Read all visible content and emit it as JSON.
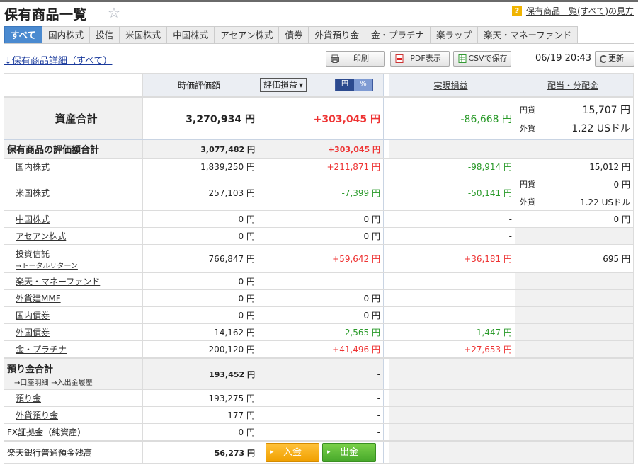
{
  "page": {
    "title": "保有商品一覧",
    "help_link": "保有商品一覧(すべて)の見方",
    "help_mark": "?"
  },
  "tabs": [
    "すべて",
    "国内株式",
    "投信",
    "米国株式",
    "中国株式",
    "アセアン株式",
    "債券",
    "外貨預り金",
    "金・プラチナ",
    "楽ラップ",
    "楽天・マネーファンド"
  ],
  "toolbar": {
    "detail_link": "↓保有商品詳細（すべて）",
    "print": "印刷",
    "pdf": "PDF表示",
    "csv": "CSVで保存",
    "datetime": "06/19 20:43",
    "refresh": "更新"
  },
  "header": {
    "market_value": "時価評価額",
    "select_value": "評価損益",
    "unit_yen": "円",
    "unit_pct": "%",
    "realized": "実現損益",
    "dividend": "配当・分配金"
  },
  "total_assets": {
    "label": "資産合計",
    "value": "3,270,934 円",
    "pl": "+303,045 円",
    "realized": "-86,668 円",
    "div_yen_label": "円貨",
    "div_yen": "15,707 円",
    "div_fx_label": "外貨",
    "div_fx": "1.22 USドル"
  },
  "holdings_total": {
    "label": "保有商品の評価額合計",
    "value": "3,077,482 円",
    "pl": "+303,045 円"
  },
  "rows": [
    {
      "label": "国内株式",
      "value": "1,839,250 円",
      "pl": "+211,871 円",
      "realized": "-98,914 円",
      "div": "15,012 円"
    },
    {
      "label": "米国株式",
      "value": "257,103 円",
      "pl": "-7,399 円",
      "realized": "-50,141 円",
      "div_yen_label": "円貨",
      "div_yen": "0 円",
      "div_fx_label": "外貨",
      "div_fx": "1.22 USドル"
    },
    {
      "label": "中国株式",
      "value": "0 円",
      "pl": "0 円",
      "realized": "-",
      "div": "0 円"
    },
    {
      "label": "アセアン株式",
      "value": "0 円",
      "pl": "0 円",
      "realized": "-",
      "div": ""
    },
    {
      "label": "投資信託",
      "sub": "→トータルリターン",
      "value": "766,847 円",
      "pl": "+59,642 円",
      "realized": "+36,181 円",
      "div": "695 円"
    },
    {
      "label": "楽天・マネーファンド",
      "value": "0 円",
      "pl": "-",
      "realized": "-",
      "div": ""
    },
    {
      "label": "外貨建MMF",
      "value": "0 円",
      "pl": "0 円",
      "realized": "-",
      "div": ""
    },
    {
      "label": "国内債券",
      "value": "0 円",
      "pl": "0 円",
      "realized": "-",
      "div": ""
    },
    {
      "label": "外国債券",
      "value": "14,162 円",
      "pl": "-2,565 円",
      "realized": "-1,447 円",
      "div": ""
    },
    {
      "label": "金・プラチナ",
      "value": "200,120 円",
      "pl": "+41,496 円",
      "realized": "+27,653 円",
      "div": ""
    }
  ],
  "deposit_total": {
    "label": "預り金合計",
    "sub1": "→口座明細",
    "sub2": "→入出金履歴",
    "value": "193,452 円",
    "pl": "-"
  },
  "deposit_rows": [
    {
      "label": "預り金",
      "value": "193,275 円",
      "pl": "-"
    },
    {
      "label": "外貨預り金",
      "value": "177 円",
      "pl": "-"
    },
    {
      "label": "FX証拠金（純資産）",
      "value": "0 円",
      "pl": "-"
    }
  ],
  "bank": {
    "label": "楽天銀行普通預金残高",
    "value": "56,273 円",
    "deposit_btn": "入金",
    "withdraw_btn": "出金"
  },
  "colors": {
    "tab_active": "#4a8ad0",
    "positive": "#e33333",
    "negative": "#2a9a2a"
  }
}
